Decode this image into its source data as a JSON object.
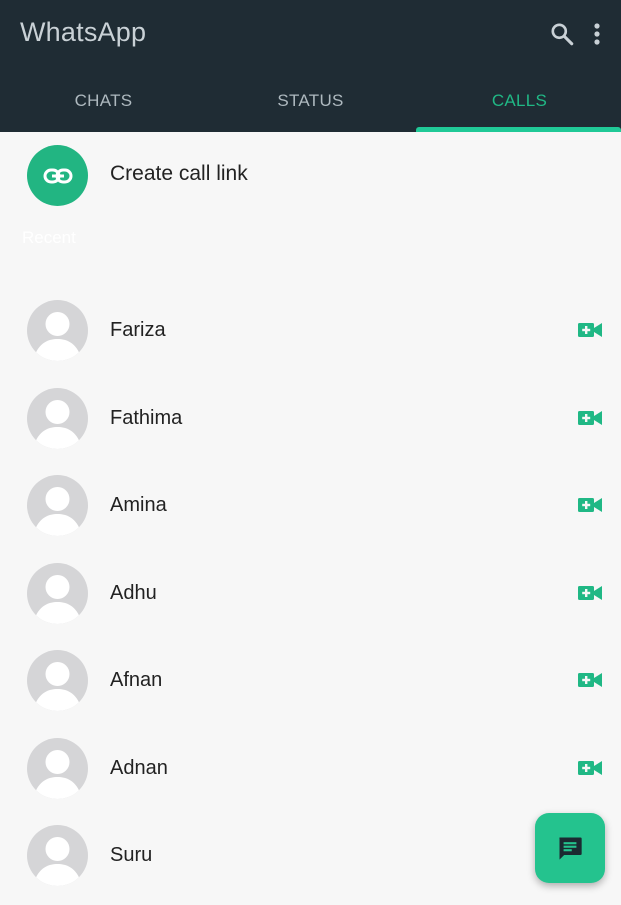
{
  "header": {
    "title": "WhatsApp",
    "search_icon": "search-icon",
    "menu_icon": "more-vert-icon"
  },
  "tabs": [
    {
      "label": "CHATS",
      "active": false
    },
    {
      "label": "STATUS",
      "active": false
    },
    {
      "label": "CALLS",
      "active": true
    }
  ],
  "call_link": {
    "label": "Create call link",
    "icon": "link-icon"
  },
  "recent_label": "Recent",
  "calls": [
    {
      "name": "Fariza"
    },
    {
      "name": "Fathima"
    },
    {
      "name": "Amina"
    },
    {
      "name": "Adhu"
    },
    {
      "name": "Afnan"
    },
    {
      "name": "Adnan"
    },
    {
      "name": "Suru"
    }
  ],
  "fab": {
    "icon": "message-icon"
  },
  "colors": {
    "header_bg": "#1f2c34",
    "accent": "#20b885",
    "fab": "#24c38e"
  }
}
